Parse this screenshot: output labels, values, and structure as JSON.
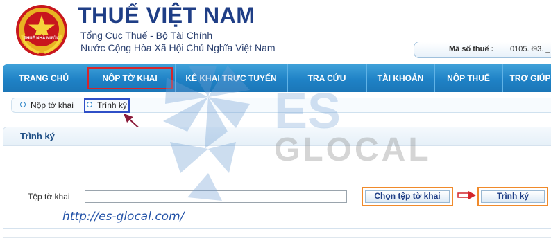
{
  "header": {
    "title": "THUẾ VIỆT NAM",
    "subtitle1": "Tổng Cục Thuế - Bộ Tài Chính",
    "subtitle2": "Nước Cộng Hòa Xã Hội Chủ Nghĩa Việt Nam",
    "emblem_text": "THUẾ NHÀ NƯỚC",
    "tax_id_label": "Mã số thuế :",
    "tax_id_value": "0105. ł93. _"
  },
  "nav": {
    "items": [
      {
        "label": "TRANG CHỦ"
      },
      {
        "label": "NỘP TỜ KHAI"
      },
      {
        "label": "KÊ KHAI TRỰC TUYẾN"
      },
      {
        "label": "TRA CỨU"
      },
      {
        "label": "TÀI KHOẢN"
      },
      {
        "label": "NỘP THUẾ"
      },
      {
        "label": "TRỢ GIÚP"
      }
    ]
  },
  "breadcrumb": {
    "items": [
      {
        "label": "Nộp tờ khai"
      },
      {
        "label": "Trình ký"
      }
    ]
  },
  "panel": {
    "title": "Trình ký",
    "file_label": "Tệp tờ khai",
    "file_value": "",
    "choose_button": "Chọn tệp tờ khai",
    "sign_button": "Trình ký"
  },
  "watermark": {
    "line1": "ES",
    "line2": "GLOCAL",
    "url": "http://es-glocal.com/"
  },
  "colors": {
    "nav_blue": "#1f82c6",
    "highlight_red": "#d4262c",
    "highlight_blue": "#2f4fc7",
    "highlight_orange": "#f08a2b"
  }
}
